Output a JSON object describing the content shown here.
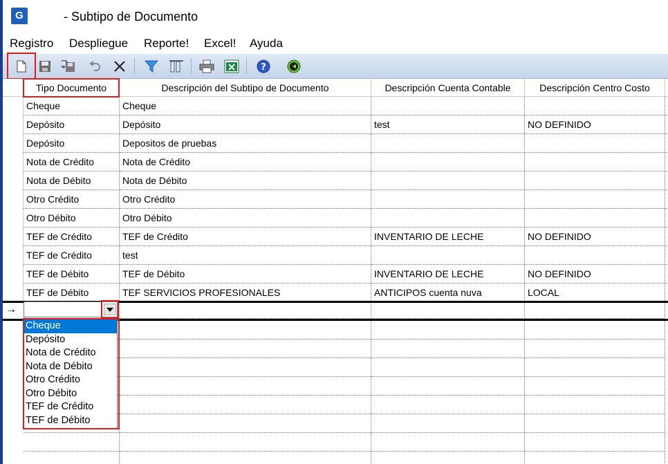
{
  "window": {
    "icon_glyph": "G",
    "title": "- Subtipo de Documento"
  },
  "menu": [
    "Registro",
    "Despliegue",
    "Reporte!",
    "Excel!",
    "Ayuda"
  ],
  "toolbar": {
    "buttons": [
      "new-document-icon",
      "save-icon",
      "undo-save-icon",
      "undo-icon",
      "delete-icon",
      "filter-icon",
      "columns-icon",
      "print-icon",
      "excel-icon",
      "help-icon",
      "exit-icon"
    ]
  },
  "grid": {
    "columns": [
      "Tipo Documento",
      "Descripción del Subtipo de Documento",
      "Descripción Cuenta Contable",
      "Descripción Centro Costo"
    ],
    "rows": [
      [
        "Cheque",
        "Cheque",
        "",
        ""
      ],
      [
        "Depósito",
        "Depósito",
        "test",
        "NO DEFINIDO"
      ],
      [
        "Depósito",
        "Depositos de pruebas",
        "",
        ""
      ],
      [
        "Nota de Crédito",
        "Nota de Crédito",
        "",
        ""
      ],
      [
        "Nota de Débito",
        "Nota de Débito",
        "",
        ""
      ],
      [
        "Otro Crédito",
        "Otro Crédito",
        "",
        ""
      ],
      [
        "Otro Débito",
        "Otro Débito",
        "",
        ""
      ],
      [
        "TEF de Crédito",
        "TEF de Crédito",
        "INVENTARIO DE LECHE",
        "NO DEFINIDO"
      ],
      [
        "TEF de Crédito",
        "test",
        "",
        ""
      ],
      [
        "TEF de Débito",
        "TEF de Débito",
        "INVENTARIO DE LECHE",
        "NO DEFINIDO"
      ],
      [
        "TEF de Débito",
        "TEF SERVICIOS PROFESIONALES",
        "ANTICIPOS cuenta nuva",
        "LOCAL"
      ]
    ],
    "new_row_indicator": "→",
    "combo_value": ""
  },
  "dropdown": {
    "options": [
      "Cheque",
      "Depósito",
      "Nota de Crédito",
      "Nota de Débito",
      "Otro Crédito",
      "Otro Débito",
      "TEF de Crédito",
      "TEF de Débito"
    ],
    "selected": "Cheque"
  },
  "colors": {
    "highlight_box": "#e01b1b",
    "selection": "#0078d7",
    "toolbar_bg": "#d3dff0"
  }
}
